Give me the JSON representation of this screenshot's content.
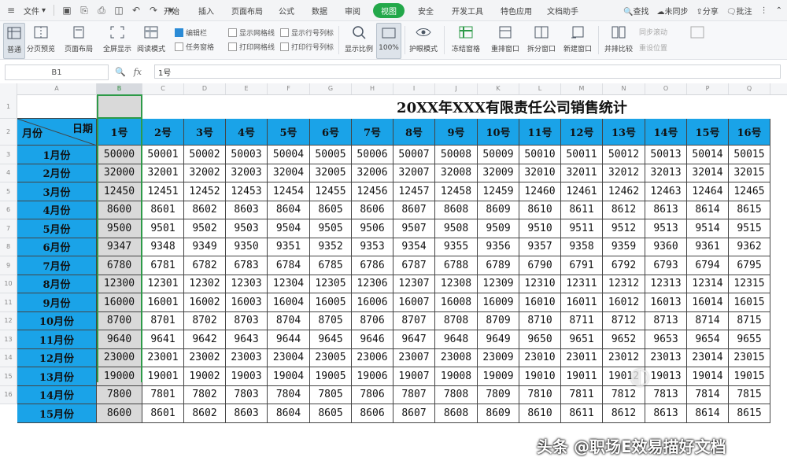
{
  "menubar": {
    "file_label": "文件",
    "tabs": [
      "开始",
      "插入",
      "页面布局",
      "公式",
      "数据",
      "审阅",
      "视图",
      "安全",
      "开发工具",
      "特色应用",
      "文档助手"
    ],
    "active_tab": "视图",
    "search_label": "查找",
    "sync_label": "未同步",
    "share_label": "分享",
    "comment_label": "批注"
  },
  "toolbar": {
    "buttons": [
      "普通",
      "分页预览",
      "页面布局",
      "全屏显示",
      "阅读模式",
      "显示比例",
      "100%",
      "护眼模式",
      "冻结窗格",
      "重排窗口",
      "拆分窗口",
      "新建窗口",
      "并排比较",
      "同步滚动",
      "重设位置"
    ],
    "checkboxes": [
      "编辑栏",
      "显示网格线",
      "显示行号列标",
      "任务窗格",
      "打印网格线",
      "打印行号列标"
    ]
  },
  "formula_bar": {
    "name_box": "B1",
    "fx_label": "fx",
    "value": "1号"
  },
  "sheet": {
    "col_headers": [
      "A",
      "B",
      "C",
      "D",
      "E",
      "F",
      "G",
      "H",
      "I",
      "J",
      "K",
      "L",
      "M",
      "N",
      "O",
      "P",
      "Q"
    ],
    "row_numbers": [
      "1",
      "2",
      "3",
      "4",
      "5",
      "6",
      "7",
      "8",
      "9",
      "10",
      "11",
      "12",
      "13",
      "14",
      "15",
      "16"
    ],
    "title": "20XX年XXX有限责任公司销售统计",
    "corner_row_label": "月份",
    "corner_col_label": "日期",
    "day_headers": [
      "1号",
      "2号",
      "3号",
      "4号",
      "5号",
      "6号",
      "7号",
      "8号",
      "9号",
      "10号",
      "11号",
      "12号",
      "13号",
      "14号",
      "15号",
      "16号"
    ],
    "months": [
      "1月份",
      "2月份",
      "3月份",
      "4月份",
      "5月份",
      "6月份",
      "7月份",
      "8月份",
      "9月份",
      "10月份",
      "11月份",
      "12月份",
      "13月份",
      "14月份",
      "15月份"
    ],
    "rows": [
      [
        "50000",
        "50001",
        "50002",
        "50003",
        "50004",
        "50005",
        "50006",
        "50007",
        "50008",
        "50009",
        "50010",
        "50011",
        "50012",
        "50013",
        "50014",
        "50015"
      ],
      [
        "32000",
        "32001",
        "32002",
        "32003",
        "32004",
        "32005",
        "32006",
        "32007",
        "32008",
        "32009",
        "32010",
        "32011",
        "32012",
        "32013",
        "32014",
        "32015"
      ],
      [
        "12450",
        "12451",
        "12452",
        "12453",
        "12454",
        "12455",
        "12456",
        "12457",
        "12458",
        "12459",
        "12460",
        "12461",
        "12462",
        "12463",
        "12464",
        "12465"
      ],
      [
        "8600",
        "8601",
        "8602",
        "8603",
        "8604",
        "8605",
        "8606",
        "8607",
        "8608",
        "8609",
        "8610",
        "8611",
        "8612",
        "8613",
        "8614",
        "8615"
      ],
      [
        "9500",
        "9501",
        "9502",
        "9503",
        "9504",
        "9505",
        "9506",
        "9507",
        "9508",
        "9509",
        "9510",
        "9511",
        "9512",
        "9513",
        "9514",
        "9515"
      ],
      [
        "9347",
        "9348",
        "9349",
        "9350",
        "9351",
        "9352",
        "9353",
        "9354",
        "9355",
        "9356",
        "9357",
        "9358",
        "9359",
        "9360",
        "9361",
        "9362"
      ],
      [
        "6780",
        "6781",
        "6782",
        "6783",
        "6784",
        "6785",
        "6786",
        "6787",
        "6788",
        "6789",
        "6790",
        "6791",
        "6792",
        "6793",
        "6794",
        "6795"
      ],
      [
        "12300",
        "12301",
        "12302",
        "12303",
        "12304",
        "12305",
        "12306",
        "12307",
        "12308",
        "12309",
        "12310",
        "12311",
        "12312",
        "12313",
        "12314",
        "12315"
      ],
      [
        "16000",
        "16001",
        "16002",
        "16003",
        "16004",
        "16005",
        "16006",
        "16007",
        "16008",
        "16009",
        "16010",
        "16011",
        "16012",
        "16013",
        "16014",
        "16015"
      ],
      [
        "8700",
        "8701",
        "8702",
        "8703",
        "8704",
        "8705",
        "8706",
        "8707",
        "8708",
        "8709",
        "8710",
        "8711",
        "8712",
        "8713",
        "8714",
        "8715"
      ],
      [
        "9640",
        "9641",
        "9642",
        "9643",
        "9644",
        "9645",
        "9646",
        "9647",
        "9648",
        "9649",
        "9650",
        "9651",
        "9652",
        "9653",
        "9654",
        "9655"
      ],
      [
        "23000",
        "23001",
        "23002",
        "23003",
        "23004",
        "23005",
        "23006",
        "23007",
        "23008",
        "23009",
        "23010",
        "23011",
        "23012",
        "23013",
        "23014",
        "23015"
      ],
      [
        "19000",
        "19001",
        "19002",
        "19003",
        "19004",
        "19005",
        "19006",
        "19007",
        "19008",
        "19009",
        "19010",
        "19011",
        "19012",
        "19013",
        "19014",
        "19015"
      ],
      [
        "7800",
        "7801",
        "7802",
        "7803",
        "7804",
        "7805",
        "7806",
        "7807",
        "7808",
        "7809",
        "7810",
        "7811",
        "7812",
        "7813",
        "7814",
        "7815"
      ],
      [
        "8600",
        "8601",
        "8602",
        "8603",
        "8604",
        "8605",
        "8606",
        "8607",
        "8608",
        "8609",
        "8610",
        "8611",
        "8612",
        "8613",
        "8614",
        "8615"
      ]
    ]
  },
  "watermark": "头条 @职场E效易描好文档",
  "colors": {
    "header_blue": "#1aa3e8",
    "selected_gray": "#d9d9d9",
    "active_tab_green": "#23a84a"
  }
}
